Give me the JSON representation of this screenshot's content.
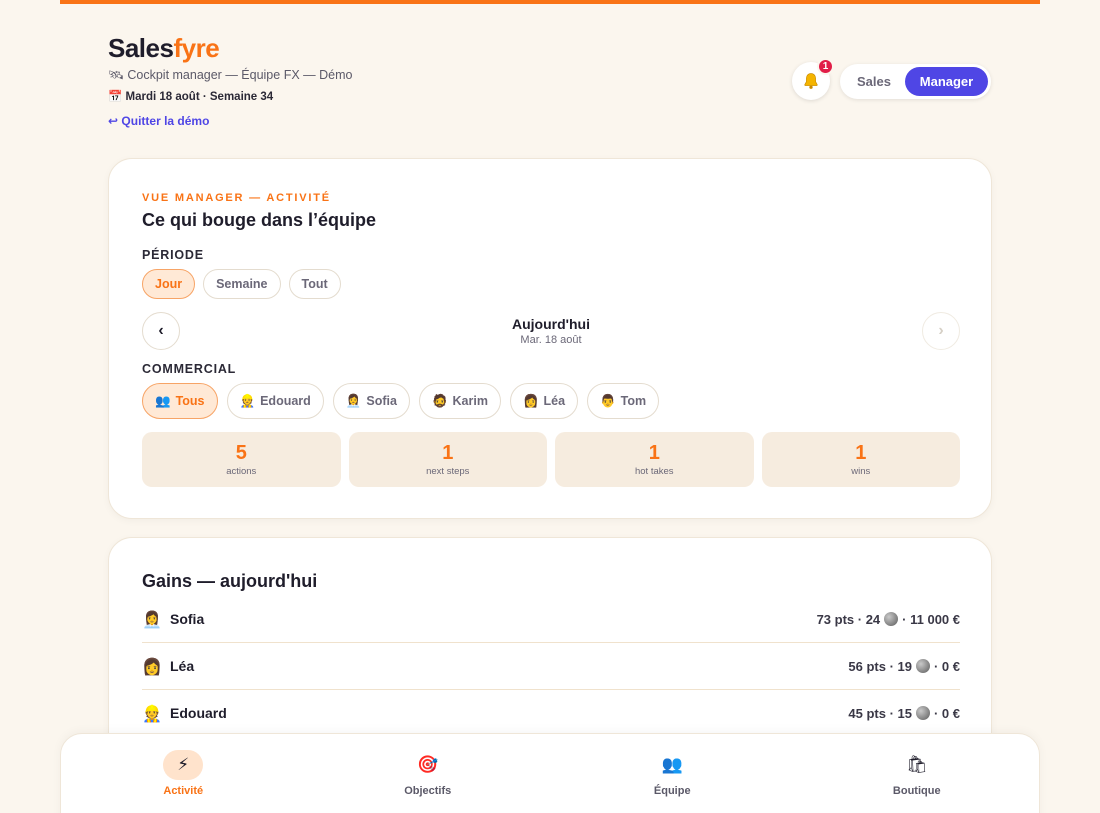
{
  "brand": {
    "name_a": "Sales",
    "name_b": "fyre"
  },
  "header": {
    "subtitle": "Cockpit manager — Équipe FX — Démo",
    "date": "Mardi 18 août · Semaine 34",
    "quit": "Quitter la démo",
    "notifications_count": "1",
    "roles": {
      "sales": "Sales",
      "manager": "Manager"
    },
    "active_role": "Manager"
  },
  "activity": {
    "eyebrow": "VUE MANAGER — ACTIVITÉ",
    "title": "Ce qui bouge dans l’équipe",
    "period_label": "PÉRIODE",
    "periods": [
      "Jour",
      "Semaine",
      "Tout"
    ],
    "active_period": "Jour",
    "current": {
      "main": "Aujourd'hui",
      "sub": "Mar. 18 août"
    },
    "prev_icon": "‹",
    "next_icon": "›",
    "commercial_label": "COMMERCIAL",
    "commercials": [
      {
        "icon": "👥",
        "name": "Tous"
      },
      {
        "icon": "👷",
        "name": "Edouard"
      },
      {
        "icon": "👩‍💼",
        "name": "Sofia"
      },
      {
        "icon": "🧔",
        "name": "Karim"
      },
      {
        "icon": "👩",
        "name": "Léa"
      },
      {
        "icon": "👨",
        "name": "Tom"
      }
    ],
    "active_commercial": "Tous",
    "stats": [
      {
        "value": "5",
        "label": "actions"
      },
      {
        "value": "1",
        "label": "next steps"
      },
      {
        "value": "1",
        "label": "hot takes"
      },
      {
        "value": "1",
        "label": "wins"
      }
    ]
  },
  "gains": {
    "title": "Gains — aujourd'hui",
    "rows": [
      {
        "icon": "👩‍💼",
        "name": "Sofia",
        "pts": "73 pts · 24",
        "amount": "· 11 000 €"
      },
      {
        "icon": "👩",
        "name": "Léa",
        "pts": "56 pts · 19",
        "amount": "· 0 €"
      },
      {
        "icon": "👷",
        "name": "Edouard",
        "pts": "45 pts · 15",
        "amount": "· 0 €"
      }
    ]
  },
  "bottom_nav": [
    {
      "icon": "⚡",
      "label": "Activité"
    },
    {
      "icon": "🎯",
      "label": "Objectifs"
    },
    {
      "icon": "👥",
      "label": "Équipe"
    },
    {
      "icon": "🛍",
      "label": "Boutique"
    }
  ],
  "active_tab": "Activité",
  "colors": {
    "accent": "#f97316",
    "primary": "#4f46e5",
    "background": "#fbf6ee"
  }
}
